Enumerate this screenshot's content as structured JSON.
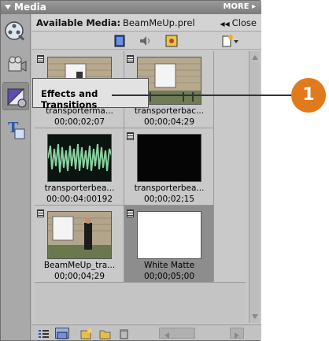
{
  "panel": {
    "title": "Media",
    "more_label": "MORE"
  },
  "header": {
    "available_label": "Available Media:",
    "filename": "BeamMeUp.prel",
    "close_label": "Close"
  },
  "tools": [
    {
      "icon": "media-film-reel-icon"
    },
    {
      "icon": "capture-camera-icon"
    },
    {
      "icon": "effects-transitions-icon"
    },
    {
      "icon": "titles-icon"
    }
  ],
  "filters": [
    {
      "icon": "video-filter-icon"
    },
    {
      "icon": "audio-filter-icon"
    },
    {
      "icon": "still-image-filter-icon"
    },
    {
      "icon": "new-item-menu-icon"
    }
  ],
  "tooltip": {
    "text": "Effects and Transitions"
  },
  "callout": {
    "number": "1"
  },
  "clips": [
    {
      "name": "transporterma...",
      "duration": "00;00;02;07",
      "thumb": "house"
    },
    {
      "name": "transporterbac...",
      "duration": "00;00;04;29",
      "thumb": "house"
    },
    {
      "name": "transporterbea...",
      "duration": "00:00:04:00192",
      "thumb": "waveform"
    },
    {
      "name": "transporterbea...",
      "duration": "00;00;02;15",
      "thumb": "black"
    },
    {
      "name": "BeamMeUp_tra...",
      "duration": "00;00;04;29",
      "thumb": "person"
    },
    {
      "name": "White Matte",
      "duration": "00;00;05;00",
      "thumb": "white"
    }
  ],
  "bottombar": [
    {
      "icon": "list-view-icon"
    },
    {
      "icon": "icon-view-icon"
    },
    {
      "icon": "new-folder-icon"
    },
    {
      "icon": "folder-icon"
    },
    {
      "icon": "trash-icon"
    }
  ],
  "colors": {
    "callout": "#e07a1c",
    "panel": "#b9b9b9",
    "selected_cell": "#8d8d8d"
  }
}
